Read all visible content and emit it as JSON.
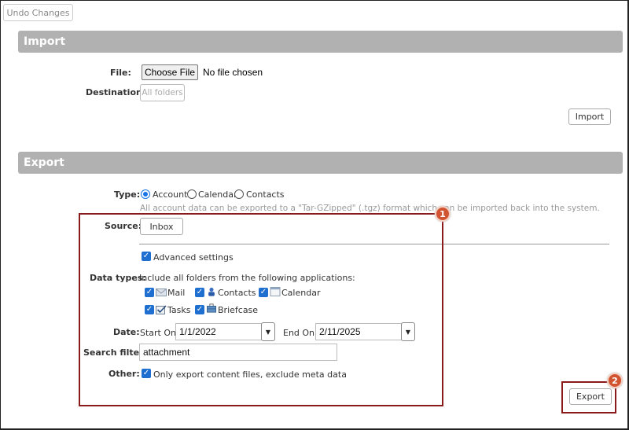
{
  "toolbar": {
    "undo_label": "Undo Changes"
  },
  "import": {
    "title": "Import",
    "file_label": "File:",
    "choose_file_label": "Choose File",
    "file_status": "No file chosen",
    "destination_label": "Destination:",
    "destination_value": "All folders",
    "import_button": "Import"
  },
  "export": {
    "title": "Export",
    "type_label": "Type:",
    "type_options": [
      {
        "label": "Account",
        "checked": true
      },
      {
        "label": "Calendar",
        "checked": false
      },
      {
        "label": "Contacts",
        "checked": false
      }
    ],
    "hint": "All account data can be exported to a \"Tar-GZipped\" (.tgz) format which can be imported back into the system.",
    "source_label": "Source:",
    "source_value": "Inbox",
    "advanced_label": "Advanced settings",
    "advanced_checked": true,
    "data_types_label": "Data types:",
    "data_types_desc": "Include all folders from the following applications:",
    "data_types": [
      {
        "label": "Mail",
        "icon": "mail-icon",
        "checked": true
      },
      {
        "label": "Contacts",
        "icon": "contacts-icon",
        "checked": true
      },
      {
        "label": "Calendar",
        "icon": "calendar-icon",
        "checked": true
      },
      {
        "label": "Tasks",
        "icon": "tasks-icon",
        "checked": true
      },
      {
        "label": "Briefcase",
        "icon": "briefcase-icon",
        "checked": true
      }
    ],
    "date_label": "Date:",
    "start_on_label": "Start On:",
    "start_on_value": "1/1/2022",
    "end_on_label": "End On:",
    "end_on_value": "2/11/2025",
    "search_filter_label": "Search filter:",
    "search_filter_value": "attachment",
    "other_label": "Other:",
    "other_option_label": "Only export content files, exclude meta data",
    "other_checked": true,
    "export_button": "Export"
  },
  "annotations": [
    {
      "number": "1"
    },
    {
      "number": "2"
    }
  ],
  "colors": {
    "section_header": "#b1b1b1",
    "checkbox": "#1f6fd1",
    "annotation_border": "#8b1a1a",
    "annotation_badge": "#d2532f"
  }
}
